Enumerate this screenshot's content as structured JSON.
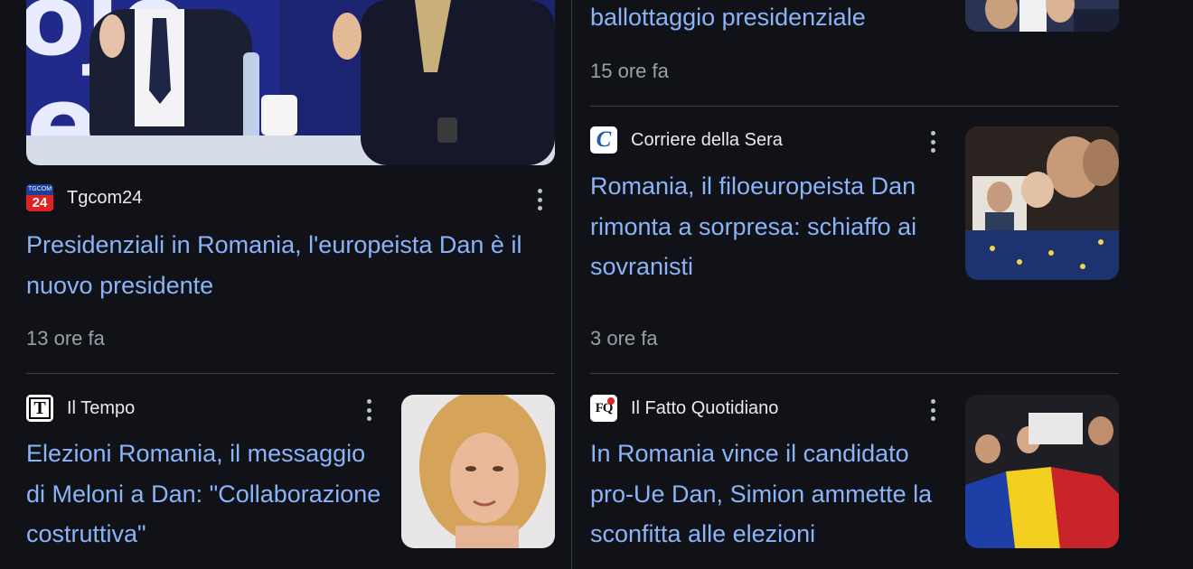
{
  "articles": [
    {
      "source": "Tgcom24",
      "logo_icon": "tgcom24-logo",
      "title": "Presidenziali in Romania, l'europeista Dan è il nuovo presidente",
      "time": "13 ore fa"
    },
    {
      "title": "ballottaggio presidenziale",
      "time": "15 ore fa"
    },
    {
      "source": "Corriere della Sera",
      "logo_icon": "corriere-logo",
      "title": "Romania, il filoeuropeista Dan rimonta a sorpresa: schiaffo ai sovranisti",
      "time": "3 ore fa"
    },
    {
      "source": "Il Tempo",
      "logo_icon": "il-tempo-logo",
      "title": "Elezioni Romania, il messaggio di Meloni a Dan: \"Collaborazione costruttiva\""
    },
    {
      "source": "Il Fatto Quotidiano",
      "logo_icon": "il-fatto-logo",
      "title": "In Romania vince il candidato pro-Ue Dan, Simion ammette la sconfitta alle elezioni"
    }
  ],
  "logos": {
    "tgcom24_small_text": "TGCOM",
    "tgcom24_number": "24",
    "corriere_letter": "C",
    "il_tempo_letter": "T",
    "il_fatto_letters": "FQ"
  },
  "colors": {
    "background": "#101218",
    "link": "#8ab4f8",
    "time": "#9aa0a6",
    "source": "#e8eaed",
    "divider": "#3c4043"
  }
}
